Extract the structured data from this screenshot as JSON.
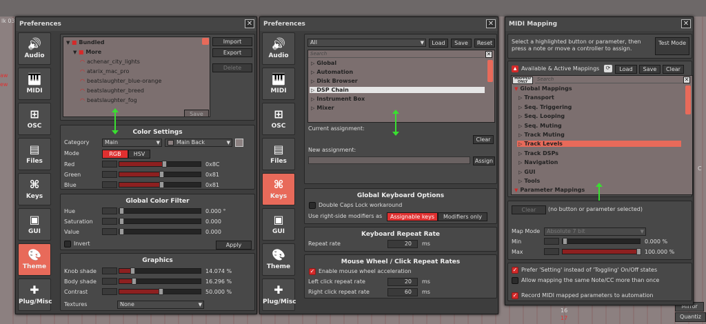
{
  "background": {
    "frag_left": "lk 03",
    "frag_v1": "aw",
    "frag_v2": "ew",
    "right_labels": [
      "Mirror",
      "Quantiz"
    ],
    "right_nums": [
      "16",
      "17"
    ],
    "frag_c": "C"
  },
  "icons": [
    "speaker-icon",
    "piano-icon",
    "network-icon",
    "files-icon",
    "key-icon",
    "gui-icon",
    "palette-icon",
    "puzzle-icon"
  ],
  "prefs1": {
    "title": "Preferences",
    "close": "✕",
    "tabs": [
      "Audio",
      "MIDI",
      "OSC",
      "Files",
      "Keys",
      "GUI",
      "Theme",
      "Plug/Misc"
    ],
    "active_tab": "Theme",
    "theme_list": {
      "items": [
        {
          "label": "Bundled",
          "level": 0
        },
        {
          "label": "More",
          "level": 1
        },
        {
          "label": "achenar_city_lights",
          "level": 2
        },
        {
          "label": "atarix_mac_pro",
          "level": 2
        },
        {
          "label": "beatslaughter_blue-orange",
          "level": 2
        },
        {
          "label": "beatslaughter_breed",
          "level": 2
        },
        {
          "label": "beatslaughter_fog",
          "level": 2
        }
      ],
      "save": "Save"
    },
    "buttons": {
      "import": "Import",
      "export": "Export",
      "delete": "Delete"
    },
    "color_settings": {
      "heading": "Color Settings",
      "category_label": "Category",
      "category_value": "Main",
      "target_value": "Main Back",
      "mode_label": "Mode",
      "mode_rgb": "RGB",
      "mode_hsv": "HSV",
      "rows": [
        {
          "label": "Red",
          "value": "0x8C",
          "level": 0.55
        },
        {
          "label": "Green",
          "value": "0x81",
          "level": 0.51
        },
        {
          "label": "Blue",
          "value": "0x81",
          "level": 0.51
        }
      ]
    },
    "global_filter": {
      "heading": "Global Color Filter",
      "rows": [
        {
          "label": "Hue",
          "value": "0.000 °"
        },
        {
          "label": "Saturation",
          "value": "0.000"
        },
        {
          "label": "Value",
          "value": "0.000"
        }
      ],
      "invert": "Invert",
      "apply": "Apply"
    },
    "graphics": {
      "heading": "Graphics",
      "rows": [
        {
          "label": "Knob shade",
          "value": "14.074 %",
          "level": 0.14
        },
        {
          "label": "Body shade",
          "value": "16.296 %",
          "level": 0.16
        },
        {
          "label": "Contrast",
          "value": "50.000 %",
          "level": 0.5
        }
      ],
      "textures_label": "Textures",
      "textures_value": "None"
    }
  },
  "prefs2": {
    "title": "Preferences",
    "close": "✕",
    "active_tab": "Keys",
    "filter": "All",
    "load": "Load",
    "save": "Save",
    "reset": "Reset",
    "search_placeholder": "Search",
    "categories": [
      "Global",
      "Automation",
      "Disk Browser",
      "DSP Chain",
      "Instrument Box",
      "Mixer"
    ],
    "selected": "DSP Chain",
    "current_label": "Current assignment:",
    "clear": "Clear",
    "new_label": "New assignment:",
    "assign": "Assign",
    "keyboard": {
      "heading": "Global Keyboard Options",
      "caps": "Double Caps Lock workaround",
      "modifiers_label": "Use right-side modifiers as",
      "assignable": "Assignable keys",
      "modifiers_only": "Modifiers only"
    },
    "repeat": {
      "heading": "Keyboard Repeat Rate",
      "label": "Repeat rate",
      "value": "20",
      "unit": "ms"
    },
    "mouse": {
      "heading": "Mouse Wheel / Click Repeat Rates",
      "enable": "Enable mouse wheel acceleration",
      "left_label": "Left click repeat rate",
      "left_value": "20",
      "right_label": "Right click repeat rate",
      "right_value": "60",
      "unit": "ms"
    }
  },
  "midi": {
    "title": "MIDI Mapping",
    "close": "✕",
    "instructions": "Select a highlighted button or parameter, then press a note or move a controller to assign.",
    "test_mode": "Test Mode",
    "available": "Available & Active Mappings",
    "load": "Load",
    "save": "Save",
    "clear": "Clear",
    "mapped_badge": "MAPPED ONLY",
    "search_placeholder": "Search",
    "tree": [
      {
        "label": "Global Mappings",
        "level": 0,
        "open": true
      },
      {
        "label": "Transport",
        "level": 1
      },
      {
        "label": "Seq. Triggering",
        "level": 1
      },
      {
        "label": "Seq. Looping",
        "level": 1
      },
      {
        "label": "Seq. Muting",
        "level": 1
      },
      {
        "label": "Track Muting",
        "level": 1
      },
      {
        "label": "Track Levels",
        "level": 1
      },
      {
        "label": "Track DSPs",
        "level": 1
      },
      {
        "label": "Navigation",
        "level": 1
      },
      {
        "label": "GUI",
        "level": 1
      },
      {
        "label": "Tools",
        "level": 1
      },
      {
        "label": "Parameter Mappings",
        "level": 0,
        "open": true
      }
    ],
    "tree_selected": "Track Levels",
    "clear_btn": "Clear",
    "no_selection": "(no button or parameter selected)",
    "map_mode_label": "Map Mode",
    "map_mode_value": "Absolute 7 bit",
    "min_label": "Min",
    "min_value": "0.000 %",
    "max_label": "Max",
    "max_value": "100.000 %",
    "opt1": "Prefer 'Setting' instead of 'Toggling' On/Off states",
    "opt2": "Allow mapping the same Note/CC more than once",
    "opt3": "Record MIDI mapped parameters to automation"
  }
}
